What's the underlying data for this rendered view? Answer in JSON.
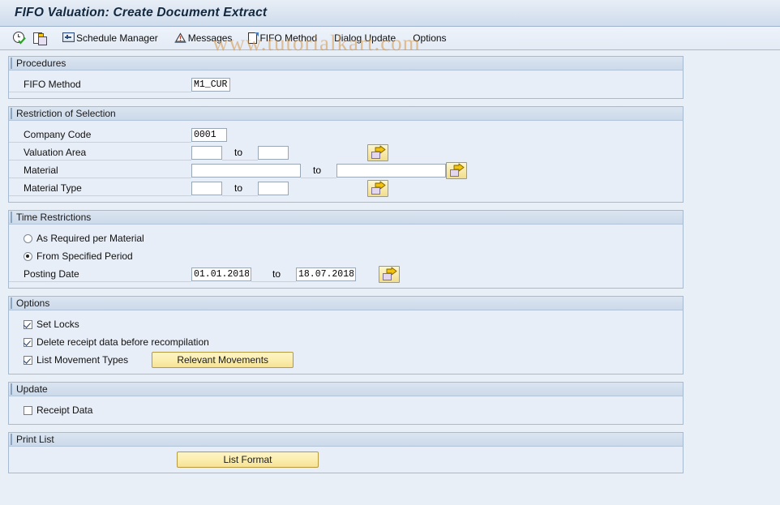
{
  "window": {
    "title": "FIFO Valuation: Create Document Extract"
  },
  "watermark": "www.tutorialkart.com",
  "toolbar": {
    "items": [
      {
        "icon": "clock-check-icon",
        "label": ""
      },
      {
        "icon": "copy-document-icon",
        "label": ""
      },
      {
        "icon": "monitor-icon",
        "label": "Schedule Manager"
      },
      {
        "icon": "messages-warning-icon",
        "label": "Messages"
      },
      {
        "icon": "document-icon",
        "label": "FIFO Method"
      },
      {
        "icon": "",
        "label": "Dialog Update"
      },
      {
        "icon": "",
        "label": "Options"
      }
    ],
    "execute_label": "",
    "schedule_manager_label": "Schedule Manager",
    "messages_label": "Messages",
    "fifo_method_label": "FIFO Method",
    "dialog_update_label": "Dialog Update",
    "options_label": "Options"
  },
  "procedures": {
    "title": "Procedures",
    "fifo_method": {
      "label": "FIFO Method",
      "value": "M1_CUR"
    }
  },
  "restriction": {
    "title": "Restriction of Selection",
    "to_label": "to",
    "rows": [
      {
        "label": "Company Code",
        "from": "0001",
        "to": null,
        "has_arrow": false
      },
      {
        "label": "Valuation Area",
        "from": "",
        "to": "",
        "has_arrow": true
      },
      {
        "label": "Material",
        "from": "",
        "to": "",
        "has_arrow": true
      },
      {
        "label": "Material Type",
        "from": "",
        "to": "",
        "has_arrow": true
      }
    ]
  },
  "time_restrictions": {
    "title": "Time Restrictions",
    "radio_as_required": {
      "label": "As Required per Material",
      "selected": false
    },
    "radio_from_period": {
      "label": "From Specified Period",
      "selected": true
    },
    "posting_date": {
      "label": "Posting Date",
      "from": "01.01.2018",
      "to_label": "to",
      "to": "18.07.2018"
    }
  },
  "options": {
    "title": "Options",
    "set_locks": {
      "label": "Set Locks",
      "checked": true
    },
    "delete_receipt": {
      "label": "Delete receipt data before recompilation",
      "checked": true
    },
    "list_movement": {
      "label": "List Movement Types",
      "checked": true
    },
    "relevant_movements_button": "Relevant Movements"
  },
  "update": {
    "title": "Update",
    "receipt_data": {
      "label": "Receipt Data",
      "checked": false
    }
  },
  "print_list": {
    "title": "Print List",
    "list_format_button": "List Format"
  },
  "colors": {
    "accent_blue": "#a6bbd2",
    "panel_bg": "#e8eef7",
    "page_bg": "#e9eff7",
    "button_yellow": "#fbeeae",
    "arrow_yellow": "#f2dd8c"
  }
}
